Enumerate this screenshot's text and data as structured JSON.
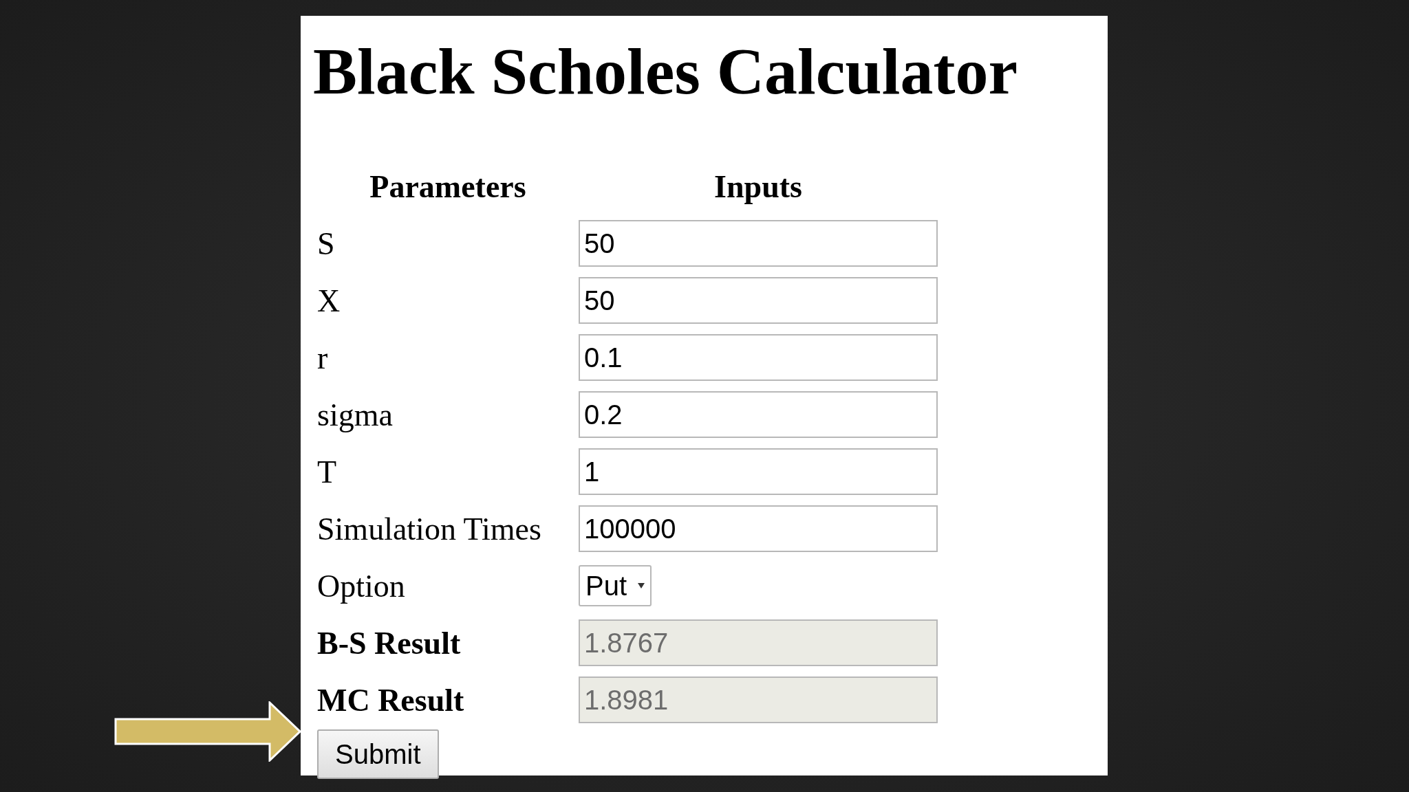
{
  "title": "Black Scholes Calculator",
  "columns": [
    "Parameters",
    "Inputs"
  ],
  "rows": [
    {
      "kind": "input",
      "label": "S",
      "value": "50"
    },
    {
      "kind": "input",
      "label": "X",
      "value": "50"
    },
    {
      "kind": "input",
      "label": "r",
      "value": "0.1"
    },
    {
      "kind": "input",
      "label": "sigma",
      "value": "0.2"
    },
    {
      "kind": "input",
      "label": "T",
      "value": "1"
    },
    {
      "kind": "input",
      "label": "Simulation Times",
      "value": "100000"
    },
    {
      "kind": "select",
      "label": "Option",
      "value": "Put"
    },
    {
      "kind": "result",
      "label": "B-S Result",
      "value": "1.8767"
    },
    {
      "kind": "result",
      "label": "MC Result",
      "value": "1.8981"
    }
  ],
  "submit": "Submit"
}
